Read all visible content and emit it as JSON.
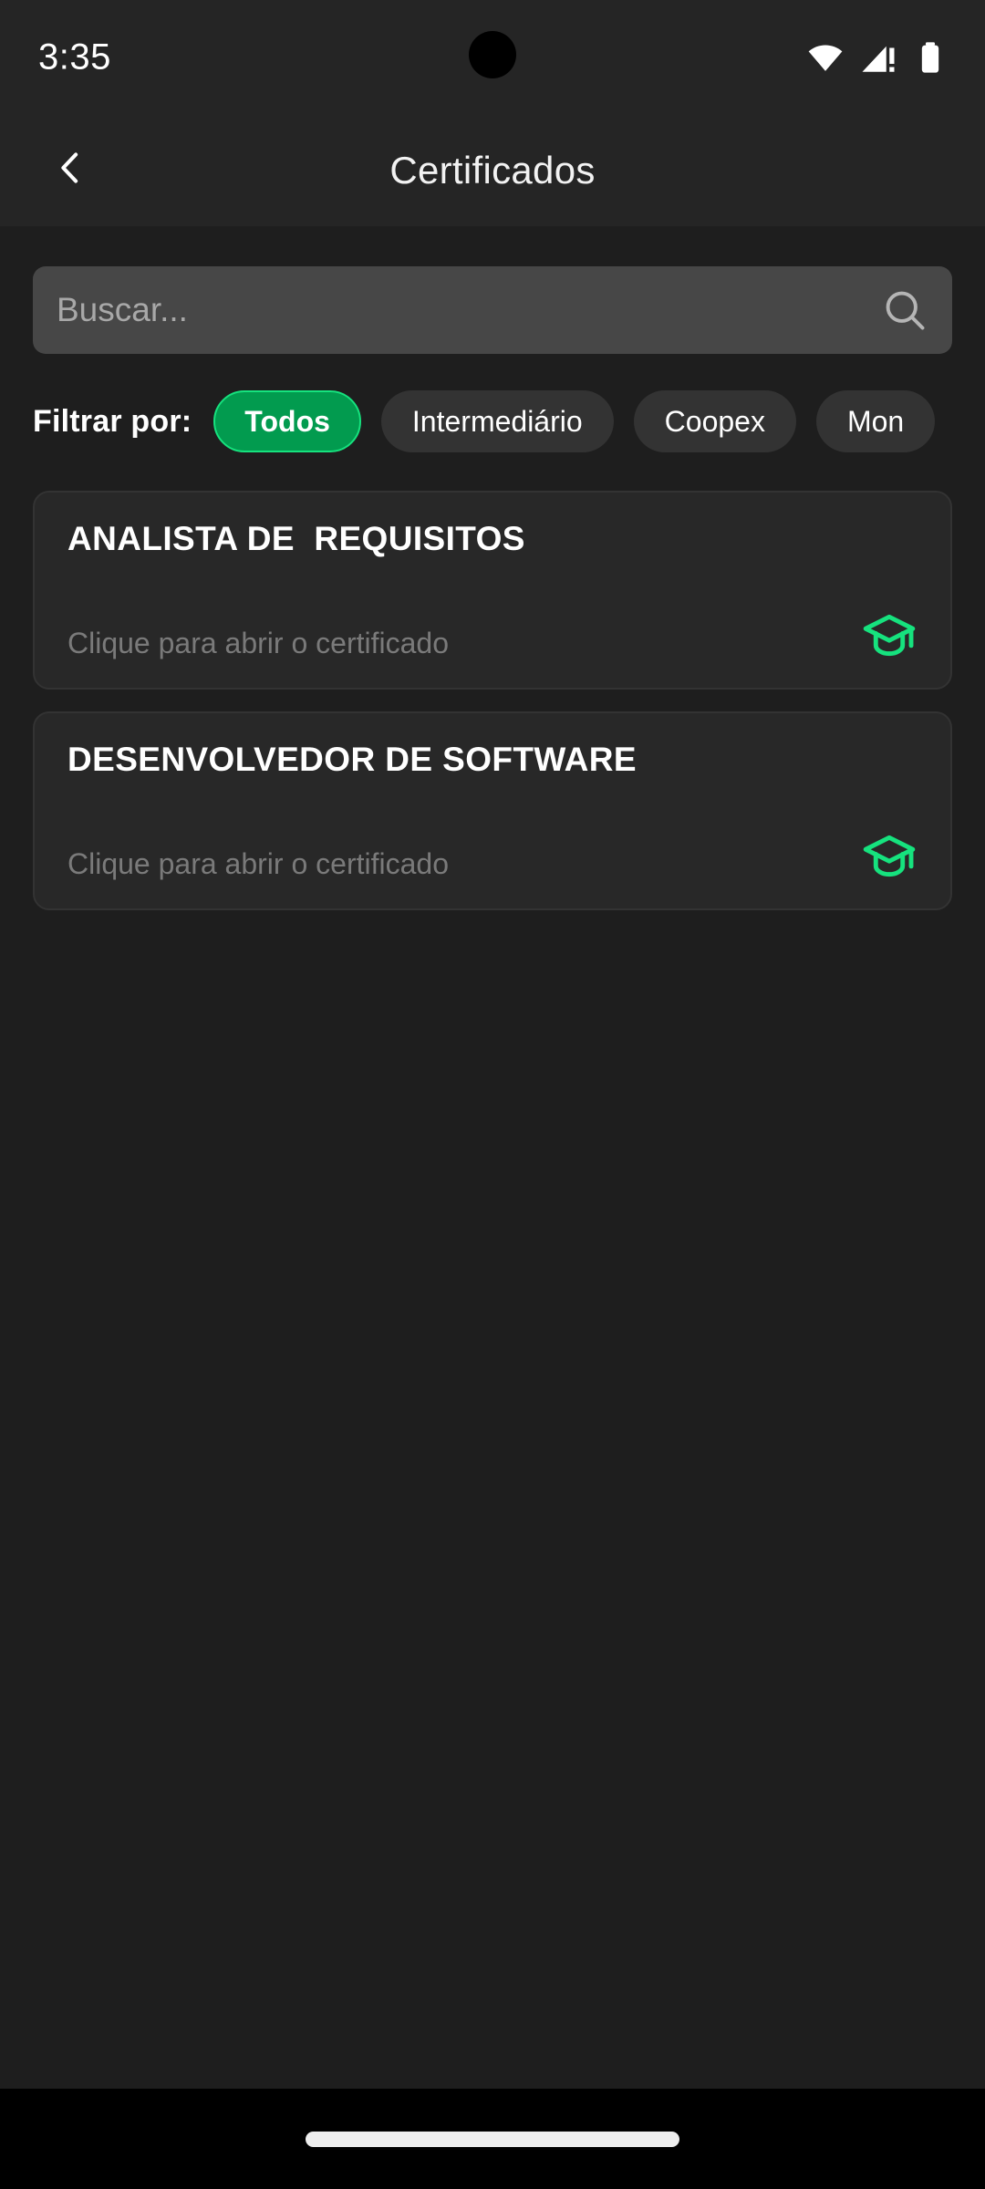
{
  "statusbar": {
    "time": "3:35",
    "icons": [
      "wifi-icon",
      "cellular-signal-warning-icon",
      "battery-full-icon"
    ]
  },
  "appbar": {
    "back_icon": "chevron-left-icon",
    "title": "Certificados"
  },
  "search": {
    "placeholder": "Buscar...",
    "value": "",
    "icon": "search-icon"
  },
  "filter": {
    "label": "Filtrar por:",
    "chips": [
      {
        "label": "Todos",
        "active": true
      },
      {
        "label": "Intermediário",
        "active": false
      },
      {
        "label": "Coopex",
        "active": false
      },
      {
        "label": "Mon",
        "active": false
      }
    ]
  },
  "certificates": [
    {
      "title": "ANALISTA DE  REQUISITOS",
      "hint": "Clique para abrir o certificado",
      "icon": "graduation-cap-icon"
    },
    {
      "title": "DESENVOLVEDOR DE SOFTWARE",
      "hint": "Clique para abrir o certificado",
      "icon": "graduation-cap-icon"
    }
  ],
  "navbar": {
    "gesture_handle": "home-gesture-pill"
  },
  "colors": {
    "accent_green": "#16e27e",
    "active_chip_bg": "#029b4f",
    "appbar_bg": "#252525",
    "page_bg": "#1e1e1e",
    "card_bg": "#282828",
    "search_bg": "#474747",
    "chip_bg": "#333333",
    "muted_text": "#7a7a7a"
  }
}
